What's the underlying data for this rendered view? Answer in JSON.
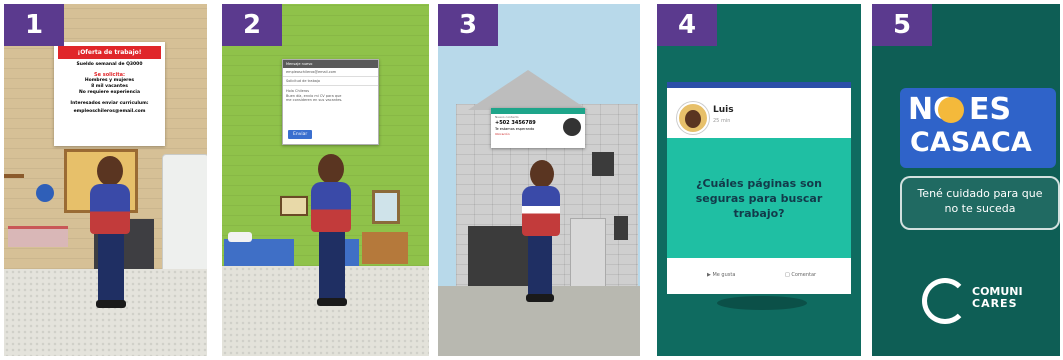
{
  "panels": [
    {
      "number": "1"
    },
    {
      "number": "2"
    },
    {
      "number": "3"
    },
    {
      "number": "4"
    },
    {
      "number": "5"
    }
  ],
  "job_poster": {
    "header": "¡Oferta de trabajo!",
    "salary": "Sueldo semanal de Q3000",
    "requested_label": "Se solicita:",
    "requirements": [
      "Hombres y mujeres",
      "8 mil vacantes",
      "No requiere experiencia"
    ],
    "interested": "Interesados enviar curriculum:",
    "email": "empleoschileros@email.com"
  },
  "email_window": {
    "title": "Mensaje nuevo",
    "to": "empleoschileros@email.com",
    "subject": "Solicitud de trabajo",
    "body": [
      "Hola Chileros",
      "Buen día, envío mi CV para que me consideren en sus vacantes."
    ],
    "send_label": "Enviar"
  },
  "contact_card": {
    "name": "Nuevo contacto",
    "phone": "+502 3456789",
    "message": "Te estamos esperando",
    "link": "Ubicación"
  },
  "post": {
    "author": "Luis",
    "time": "25 min",
    "question": "¿Cuáles páginas son seguras para buscar trabajo?",
    "like_label": "Me gusta",
    "comment_label": "Comentar"
  },
  "campaign": {
    "slogan_line1": "NO ES",
    "slogan_line2": "CASACA",
    "tagline": "Tené cuidado para que no te suceda",
    "brand_line1": "COMUNI",
    "brand_line2": "CARES"
  },
  "colors": {
    "badge": "#5b3a8e",
    "poster_red": "#e0262a",
    "post_teal": "#1fbfa3",
    "slogan_blue": "#2f63c9",
    "wall_green": "#8fc24a"
  }
}
